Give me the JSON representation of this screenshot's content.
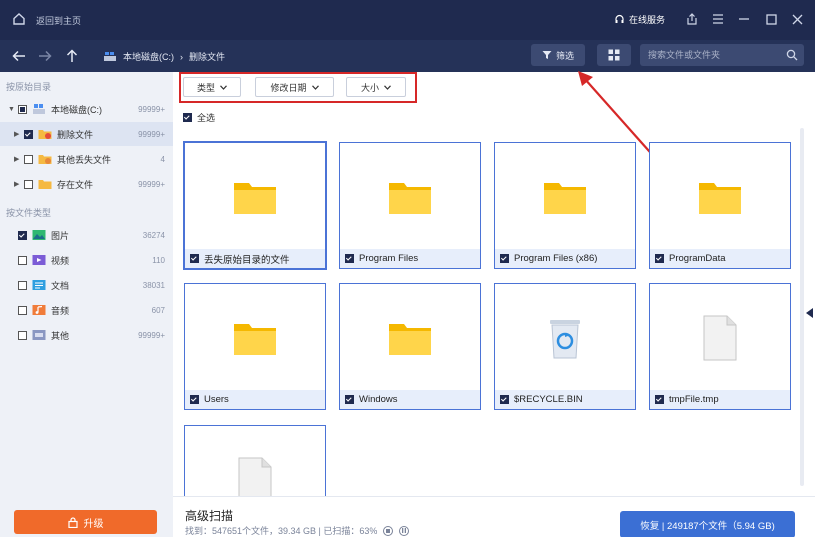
{
  "titlebar": {
    "back_home": "返回到主页",
    "online_service": "在线服务"
  },
  "navbar": {
    "breadcrumb": [
      "本地磁盘(C:)",
      "删除文件"
    ],
    "filter_label": "筛选",
    "search_placeholder": "搜索文件或文件夹"
  },
  "sidebar": {
    "section_dir": "按原始目录",
    "dir_items": [
      {
        "label": "本地磁盘(C:)",
        "count": "99999+"
      },
      {
        "label": "删除文件",
        "count": "99999+"
      },
      {
        "label": "其他丢失文件",
        "count": "4"
      },
      {
        "label": "存在文件",
        "count": "99999+"
      }
    ],
    "section_type": "按文件类型",
    "type_items": [
      {
        "label": "图片",
        "count": "36274"
      },
      {
        "label": "视频",
        "count": "110"
      },
      {
        "label": "文档",
        "count": "38031"
      },
      {
        "label": "音频",
        "count": "607"
      },
      {
        "label": "其他",
        "count": "99999+"
      }
    ],
    "upgrade_label": "升级"
  },
  "filters": {
    "type": "类型",
    "modified": "修改日期",
    "size": "大小",
    "select_all": "全选"
  },
  "files": [
    {
      "name": "丢失原始目录的文件",
      "icon": "folder-icon"
    },
    {
      "name": "Program Files",
      "icon": "folder-icon"
    },
    {
      "name": "Program Files (x86)",
      "icon": "folder-icon"
    },
    {
      "name": "ProgramData",
      "icon": "folder-icon"
    },
    {
      "name": "Users",
      "icon": "folder-icon"
    },
    {
      "name": "Windows",
      "icon": "folder-icon"
    },
    {
      "name": "$RECYCLE.BIN",
      "icon": "recycle-bin-icon"
    },
    {
      "name": "tmpFile.tmp",
      "icon": "file-icon"
    },
    {
      "name": "",
      "icon": "file-icon"
    }
  ],
  "bottom": {
    "title": "高级扫描",
    "status": "找到：547651个文件，39.34 GB | 已扫描：63%",
    "recover_label": "恢复 | 249187个文件（5.94 GB)"
  },
  "colors": {
    "titlebar": "#1f2a4f",
    "accent": "#3b6fd4",
    "upgrade": "#f06a2a",
    "highlight": "#d62828"
  }
}
